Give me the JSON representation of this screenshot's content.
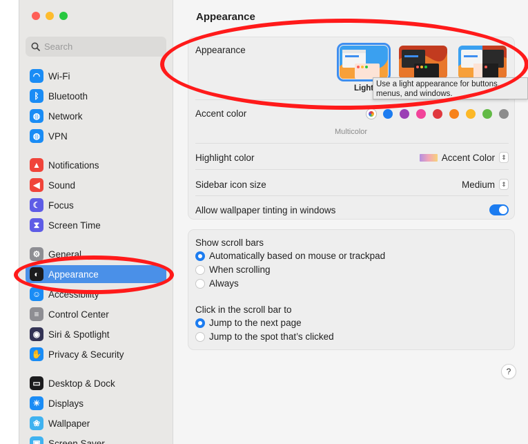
{
  "search": {
    "placeholder": "Search"
  },
  "sidebar": {
    "items": [
      {
        "label": "Wi-Fi",
        "icon": "wifi-icon",
        "color": "#1a8cf5",
        "glyph": "◠"
      },
      {
        "label": "Bluetooth",
        "icon": "bluetooth-icon",
        "color": "#1a8cf5",
        "glyph": "ᛒ"
      },
      {
        "label": "Network",
        "icon": "globe-icon",
        "color": "#1a8cf5",
        "glyph": "◍"
      },
      {
        "label": "VPN",
        "icon": "vpn-icon",
        "color": "#1a8cf5",
        "glyph": "◍"
      },
      {
        "label": "Notifications",
        "icon": "bell-icon",
        "color": "#f0443a",
        "glyph": "▲"
      },
      {
        "label": "Sound",
        "icon": "speaker-icon",
        "color": "#f0443a",
        "glyph": "◀"
      },
      {
        "label": "Focus",
        "icon": "moon-icon",
        "color": "#5e5ce6",
        "glyph": "☾"
      },
      {
        "label": "Screen Time",
        "icon": "hourglass-icon",
        "color": "#5e5ce6",
        "glyph": "⧗"
      },
      {
        "label": "General",
        "icon": "gear-icon",
        "color": "#8e8e93",
        "glyph": "⚙"
      },
      {
        "label": "Appearance",
        "icon": "appearance-icon",
        "color": "#1c1c1e",
        "glyph": "◐"
      },
      {
        "label": "Accessibility",
        "icon": "accessibility-icon",
        "color": "#1a8cf5",
        "glyph": "☺"
      },
      {
        "label": "Control Center",
        "icon": "toggles-icon",
        "color": "#8e8e93",
        "glyph": "≡"
      },
      {
        "label": "Siri & Spotlight",
        "icon": "siri-icon",
        "color": "#333355",
        "glyph": "◉"
      },
      {
        "label": "Privacy & Security",
        "icon": "hand-icon",
        "color": "#1a8cf5",
        "glyph": "✋"
      },
      {
        "label": "Desktop & Dock",
        "icon": "dock-icon",
        "color": "#1c1c1e",
        "glyph": "▭"
      },
      {
        "label": "Displays",
        "icon": "sun-icon",
        "color": "#1a8cf5",
        "glyph": "☀"
      },
      {
        "label": "Wallpaper",
        "icon": "flower-icon",
        "color": "#3fb2f0",
        "glyph": "❀"
      },
      {
        "label": "Screen Saver",
        "icon": "screensaver-icon",
        "color": "#3fb2f0",
        "glyph": "▣"
      }
    ]
  },
  "main": {
    "title": "Appearance",
    "appearance": {
      "label": "Appearance",
      "selected_caption": "Light",
      "tooltip": "Use a light appearance for buttons, menus, and windows."
    },
    "accent": {
      "label": "Accent color",
      "caption": "Multicolor",
      "colors": [
        "#1c7cf0",
        "#9b3fb5",
        "#f2439a",
        "#e0383e",
        "#f7821b",
        "#fcb827",
        "#62ba46",
        "#8c8c8c"
      ]
    },
    "highlight": {
      "label": "Highlight color",
      "value": "Accent Color"
    },
    "sidebar_icon_size": {
      "label": "Sidebar icon size",
      "value": "Medium"
    },
    "wallpaper_tinting": {
      "label": "Allow wallpaper tinting in windows",
      "on": true
    },
    "scroll_bars": {
      "label": "Show scroll bars",
      "options": [
        "Automatically based on mouse or trackpad",
        "When scrolling",
        "Always"
      ],
      "selected": 0
    },
    "click_scroll": {
      "label": "Click in the scroll bar to",
      "options": [
        "Jump to the next page",
        "Jump to the spot that’s clicked"
      ],
      "selected": 0
    },
    "help_label": "?"
  }
}
